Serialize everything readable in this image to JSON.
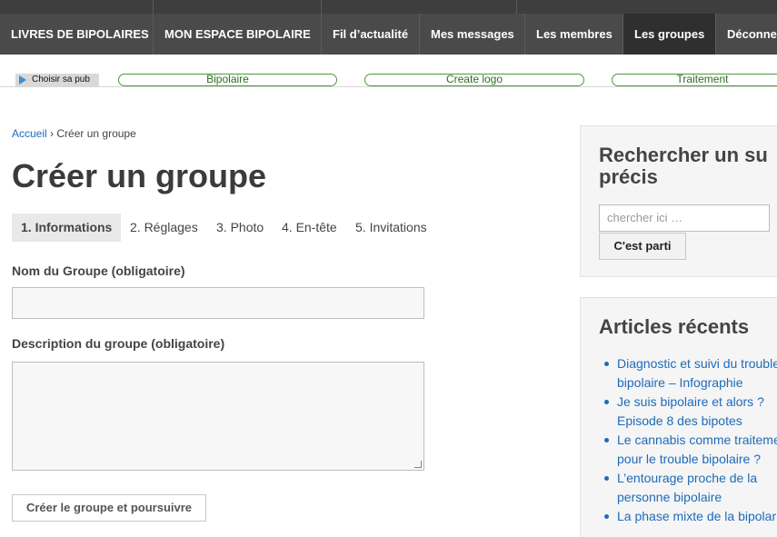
{
  "nav": {
    "items": [
      {
        "label": "LIVRES DE BIPOLAIRES",
        "active": false
      },
      {
        "label": "MON ESPACE BIPOLAIRE",
        "active": false
      },
      {
        "label": "Fil d’actualité",
        "active": false
      },
      {
        "label": "Mes messages",
        "active": false
      },
      {
        "label": "Les membres",
        "active": false
      },
      {
        "label": "Les groupes",
        "active": true
      },
      {
        "label": "Déconne",
        "active": false
      }
    ]
  },
  "ads": {
    "choices_label": "Choisir sa pub",
    "links": [
      "Bipolaire",
      "Create logo",
      "Traitement"
    ]
  },
  "breadcrumb": {
    "home": "Accueil",
    "separator": "›",
    "current": "Créer un groupe"
  },
  "page": {
    "title": "Créer un groupe"
  },
  "steps": [
    {
      "label": "1. Informations",
      "active": true
    },
    {
      "label": "2. Réglages",
      "active": false
    },
    {
      "label": "3. Photo",
      "active": false
    },
    {
      "label": "4. En-tête",
      "active": false
    },
    {
      "label": "5. Invitations",
      "active": false
    }
  ],
  "form": {
    "name_label": "Nom du Groupe (obligatoire)",
    "name_value": "",
    "description_label": "Description du groupe (obligatoire)",
    "description_value": "",
    "submit_label": "Créer le groupe et poursuivre"
  },
  "sidebar": {
    "search": {
      "title_line1": "Rechercher un su",
      "title_line2": "précis",
      "placeholder": "chercher ici …",
      "button_label": "C'est parti"
    },
    "recent": {
      "title": "Articles récents",
      "articles": [
        {
          "line1": "Diagnostic et suivi du trouble",
          "line2": "bipolaire – Infographie"
        },
        {
          "line1": "Je suis bipolaire et alors ?",
          "line2": "Episode 8 des bipotes"
        },
        {
          "line1": "Le cannabis comme traiteme",
          "line2": "pour le trouble bipolaire ?"
        },
        {
          "line1": "L’entourage proche de la",
          "line2": "personne bipolaire"
        },
        {
          "line1": "La phase mixte de la bipolar",
          "line2": ""
        }
      ]
    }
  },
  "colors": {
    "nav_bg": "#4a4a4a",
    "nav_active_bg": "#2f2f2f",
    "link": "#1e6bb8",
    "ad_green": "#4b9b3a"
  }
}
